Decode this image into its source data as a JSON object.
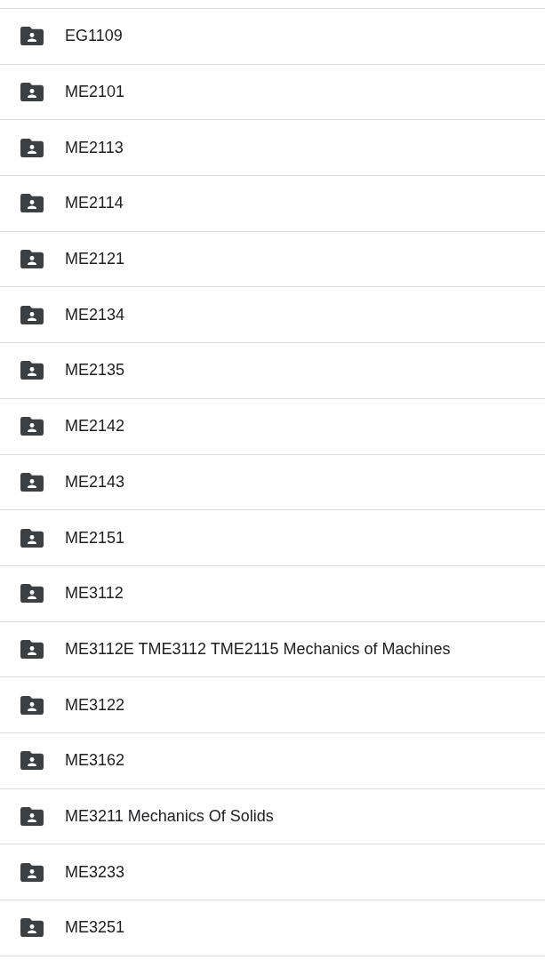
{
  "folders": [
    {
      "name": "EG1109"
    },
    {
      "name": "ME2101"
    },
    {
      "name": "ME2113"
    },
    {
      "name": "ME2114"
    },
    {
      "name": "ME2121"
    },
    {
      "name": "ME2134"
    },
    {
      "name": "ME2135"
    },
    {
      "name": "ME2142"
    },
    {
      "name": "ME2143"
    },
    {
      "name": "ME2151"
    },
    {
      "name": "ME3112"
    },
    {
      "name": "ME3112E TME3112 TME2115 Mechanics of Machines"
    },
    {
      "name": "ME3122"
    },
    {
      "name": "ME3162"
    },
    {
      "name": "ME3211 Mechanics Of Solids"
    },
    {
      "name": "ME3233"
    },
    {
      "name": "ME3251"
    }
  ]
}
